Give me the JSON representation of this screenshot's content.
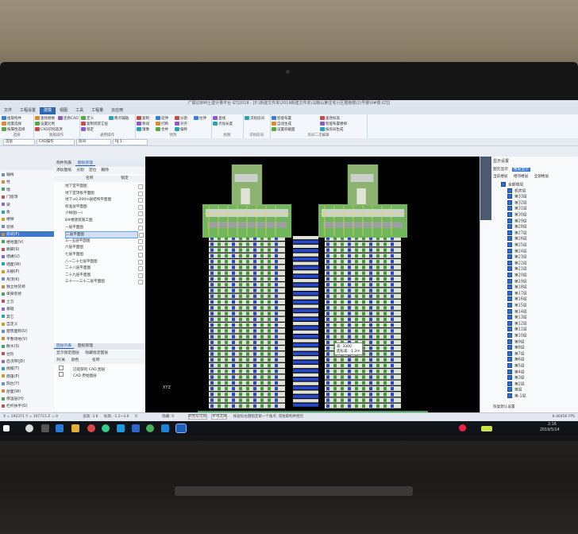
{
  "app": {
    "title": "广联达BIM土建计量平台 GTJ2018 - [E:\\新建文件夹\\2019新建文件夹\\马鞍山某住宅小区楼南楼(2)号楼\\0#楼.GTJ]",
    "tabs": [
      "文件",
      "工程设置",
      "建模",
      "视图",
      "工具",
      "工程量",
      "云应用"
    ],
    "active_tab": "建模"
  },
  "ribbon": {
    "groups": [
      {
        "label": "选择",
        "items": [
          "拾取构件",
          "批量选择",
          "按属性选择"
        ]
      },
      {
        "label": "图纸操作",
        "items": [
          "查找替换",
          "设置比例",
          "CAD识别选项",
          "还原CAD"
        ]
      },
      {
        "label": "通用操作",
        "items": [
          "定义",
          "复制到其它层",
          "锁定",
          "两点辅轴"
        ]
      },
      {
        "label": "修改",
        "items": [
          "复制",
          "移动",
          "镜像",
          "延伸",
          "打断",
          "合并",
          "分割",
          "对齐",
          "偏移",
          "拉伸"
        ]
      },
      {
        "label": "绘图",
        "items": [
          "直线",
          "点加长度"
        ]
      },
      {
        "label": "识别房间",
        "items": [
          "识别房间"
        ]
      },
      {
        "label": "房间二次编辑",
        "items": [
          "智能布置",
          "自动生成",
          "设置斜截面",
          "查改标高",
          "智能布置楼梯",
          "按房间生成"
        ]
      }
    ]
  },
  "selectors": [
    "首层",
    "CAD操作",
    "房间",
    "RJ-1"
  ],
  "left_nav": {
    "items": [
      "轴线",
      "柱",
      "墙",
      "门窗洞",
      "梁",
      "板",
      "楼梯",
      "装修",
      "房间(F)",
      "楼地面(V)",
      "踢脚(S)",
      "墙裙(U)",
      "墙面(W)",
      "天棚(P)",
      "吊顶(K)",
      "独立柱装修",
      "单梁装修",
      "土方",
      "基础",
      "其它",
      "自定义",
      "建筑面积(U)",
      "平整场地(V)",
      "散水(S)",
      "台阶",
      "后浇带(JD)",
      "挑檐(T)",
      "雨篷(P)",
      "阳台(Y)",
      "屋面(W)",
      "保温层(H)",
      "栏杆扶手(G)"
    ],
    "selected": "房间(F)"
  },
  "floor_panel": {
    "tabs": [
      "构件列表",
      "图纸管理"
    ],
    "active_tab": "图纸管理",
    "toolbar": [
      "添加图纸",
      "分割",
      "定位",
      "删除"
    ],
    "columns": [
      "名称",
      "锁定"
    ],
    "rows": [
      "地下室平面图",
      "地下室顶板平面图",
      "地下±0.000m层结构平面图",
      "标准层平面图",
      "小样图(一)",
      "B#楼建筑施工图",
      "一层平面图",
      "二层平面图",
      "三~五层平面图",
      "六层平面图",
      "七层平面图",
      "八~二十七层平面图",
      "二十八层平面图",
      "二十九层平面图",
      "三十一~三十二层平面图"
    ],
    "selected_row": "二层平面图"
  },
  "layer_panel": {
    "tabs": [
      "图层列表",
      "图纸管理"
    ],
    "options": [
      "显示指定图层",
      "隐藏指定图层"
    ],
    "columns": [
      "开/关",
      "颜色",
      "名称"
    ],
    "rows": [
      "已提取的 CAD 图层",
      "CAD 原始图层"
    ]
  },
  "view": {
    "tooltip": "高: 3300\n底标高: -1.2m",
    "axis_label": "XYZ"
  },
  "right_panel": {
    "title": "显示设置",
    "tabs": [
      "图元显示",
      "楼层显示"
    ],
    "options": [
      "当前楼层",
      "相邻楼层",
      "全部楼层"
    ],
    "floors": [
      "全部楼层",
      "机房层",
      "第33层",
      "第32层",
      "第31层",
      "第30层",
      "第29层",
      "第28层",
      "第27层",
      "第26层",
      "第25层",
      "第24层",
      "第23层",
      "第22层",
      "第21层",
      "第20层",
      "第19层",
      "第18层",
      "第17层",
      "第16层",
      "第15层",
      "第14层",
      "第13层",
      "第12层",
      "第11层",
      "第10层",
      "第9层",
      "第8层",
      "第7层",
      "第6层",
      "第5层",
      "第4层",
      "第3层",
      "第2层",
      "首层",
      "第-1层"
    ],
    "footer": "恢复默认设置"
  },
  "status_bar": {
    "coords": "X = 192371  Y = 107715  Z = 0",
    "floor_height": "层高: 3.6",
    "elevation": "标高: -1.2~3.6",
    "count": "0",
    "hidden": "隐藏: 0",
    "modes": [
      "跨图层选择",
      "折线选择"
    ],
    "hint": "按鼠标左键指定第一个角点, 或拾取构件图元",
    "fps": "8.46456 FPS"
  },
  "taskbar": {
    "time": "2:16",
    "date": "2019/5/14"
  },
  "colors": {
    "ribbon_accent": "#2f67b1",
    "nav_selected": "#3d78c9",
    "viewport_bg": "#000000",
    "checkbox": "#2f6dd0"
  }
}
